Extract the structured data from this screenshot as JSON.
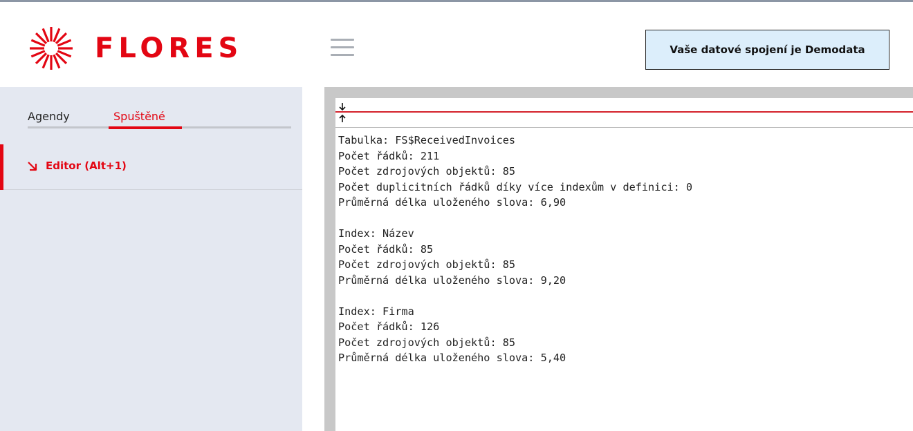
{
  "header": {
    "logo_text": "FLORES",
    "connection_button": "Vaše datové spojení je Demodata"
  },
  "sidebar": {
    "tabs": [
      {
        "label": "Agendy"
      },
      {
        "label": "Spuštěné",
        "active": true
      }
    ],
    "items": [
      {
        "label": "Editor (Alt+1)",
        "icon": "arrow-down-right-icon",
        "active": true
      }
    ]
  },
  "editor": {
    "lines": [
      "Tabulka: FS$ReceivedInvoices",
      "Počet řádků: 211",
      "Počet zdrojových objektů: 85",
      "Počet duplicitních řádků díky více indexům v definici: 0",
      "Průměrná délka uloženého slova: 6,90",
      "",
      "Index: Název",
      "Počet řádků: 85",
      "Počet zdrojových objektů: 85",
      "Průměrná délka uloženého slova: 9,20",
      "",
      "Index: Firma",
      "Počet řádků: 126",
      "Počet zdrojových objektů: 85",
      "Průměrná délka uloženého slova: 5,40"
    ]
  },
  "colors": {
    "brand_red": "#e30613",
    "sidebar_bg": "#e4e8f1",
    "button_bg": "#dceefb"
  }
}
